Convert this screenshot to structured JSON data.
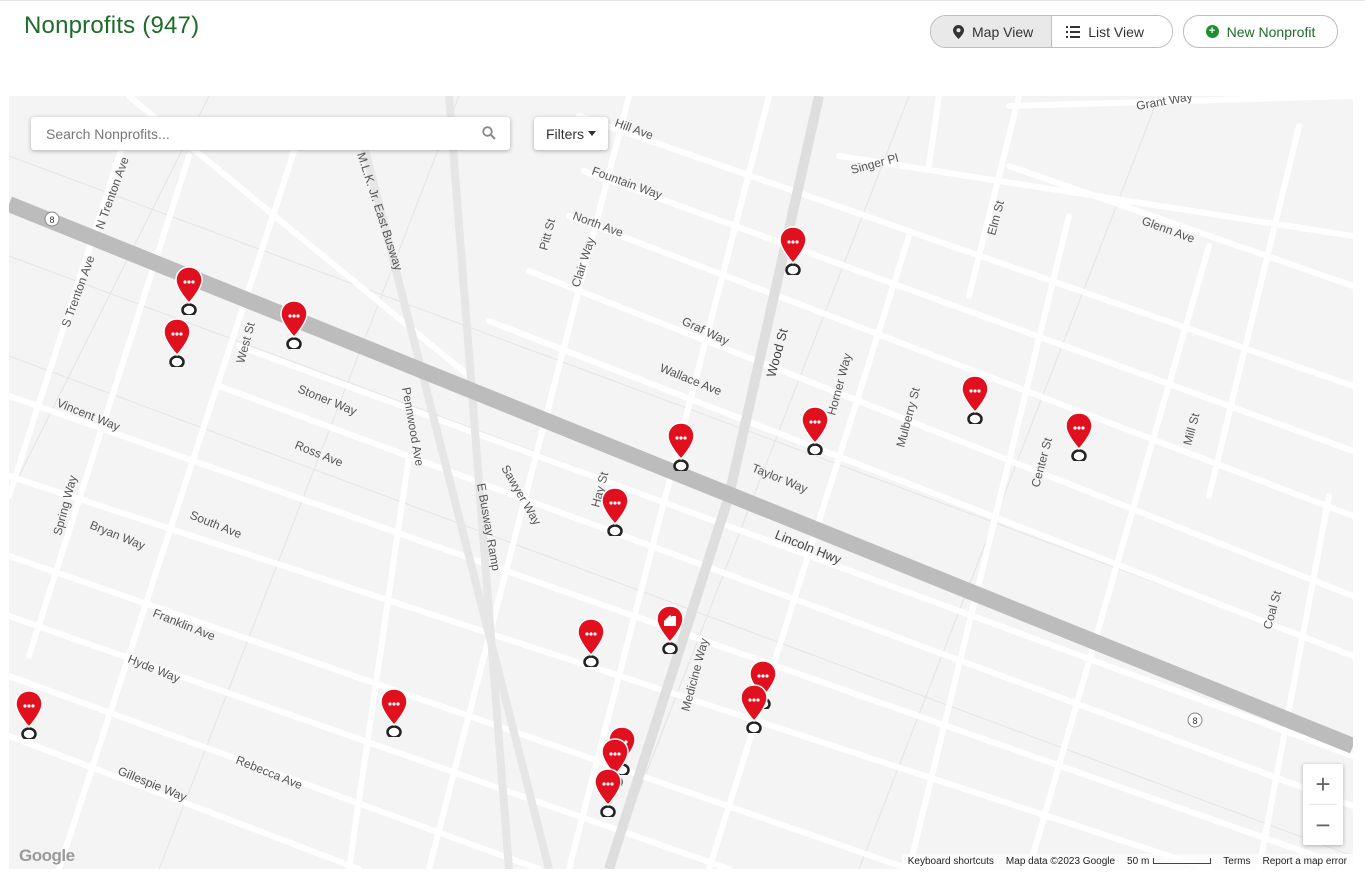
{
  "header": {
    "title": "Nonprofits (947)",
    "map_view_label": "Map View",
    "list_view_label": "List View",
    "new_label": "New Nonprofit"
  },
  "search": {
    "placeholder": "Search Nonprofits..."
  },
  "filters_label": "Filters",
  "map": {
    "streets": [
      "Hill Ave",
      "Fountain Way",
      "North Ave",
      "Graf Way",
      "Wallace Ave",
      "Taylor Way",
      "Stoner Way",
      "Ross Ave",
      "South Ave",
      "Vincent Way",
      "Bryan Way",
      "Franklin Ave",
      "Hyde Way",
      "Rebecca Ave",
      "Gillespie Way",
      "Spring Way",
      "Pitt St",
      "Clair Way",
      "Wood St",
      "Singer Pl",
      "Elm St",
      "Grant Way",
      "Glenn Ave",
      "Mill St",
      "Coal St",
      "Center St",
      "Mulberry St",
      "Horner Way",
      "Hay St",
      "Sawyer Way",
      "Medicine Way",
      "Pennwood Ave",
      "West St",
      "N Trenton Ave",
      "S Trenton Ave",
      "M.L.K. Jr. East Busway",
      "E Busway Ramp",
      "Lincoln Hwy"
    ],
    "route_shield": "8",
    "google_logo": "Google",
    "attribution": [
      "Keyboard shortcuts",
      "Map data ©2023 Google",
      "50 m",
      "Terms",
      "Report a map error"
    ]
  },
  "markers": [
    {
      "type": "more"
    },
    {
      "type": "more"
    },
    {
      "type": "more"
    },
    {
      "type": "more"
    },
    {
      "type": "more"
    },
    {
      "type": "more"
    },
    {
      "type": "more"
    },
    {
      "type": "more"
    },
    {
      "type": "more"
    },
    {
      "type": "more"
    },
    {
      "type": "building"
    },
    {
      "type": "more"
    },
    {
      "type": "more"
    },
    {
      "type": "more"
    },
    {
      "type": "more"
    },
    {
      "type": "more"
    },
    {
      "type": "more"
    },
    {
      "type": "more"
    }
  ],
  "colors": {
    "accent": "#1e6b2a",
    "marker": "#e0101e"
  },
  "zoom": {
    "in": "+",
    "out": "−"
  }
}
